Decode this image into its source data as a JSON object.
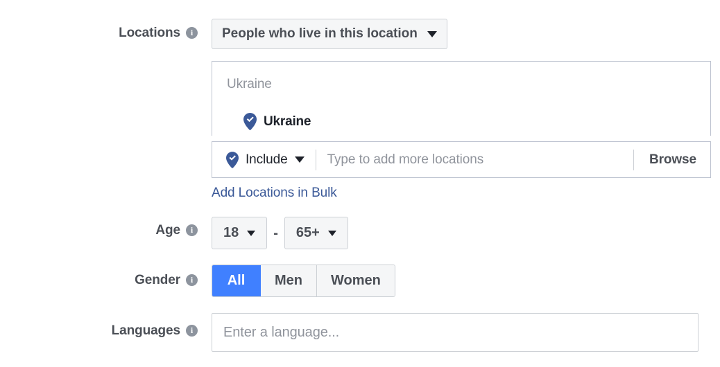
{
  "colors": {
    "brand_blue": "#3b5998",
    "accent_blue": "#4080ff",
    "label_gray": "#4b4f56",
    "placeholder_gray": "#90949c",
    "border_gray": "#ccd0d5",
    "box_border": "#bdc3d0",
    "field_bg": "#f5f6f7"
  },
  "locations": {
    "label": "Locations",
    "info_icon": "info-icon",
    "type_select": {
      "value": "People who live in this location",
      "caret_icon": "chevron-down-icon"
    },
    "results": {
      "group_header": "Ukraine",
      "items": [
        {
          "name": "Ukraine",
          "icon": "map-pin-check-icon"
        }
      ]
    },
    "input_row": {
      "mode": {
        "label": "Include",
        "icon": "map-pin-check-icon",
        "caret_icon": "chevron-down-icon"
      },
      "search_placeholder": "Type to add more locations",
      "search_value": "",
      "browse_label": "Browse"
    },
    "bulk_link": "Add Locations in Bulk"
  },
  "age": {
    "label": "Age",
    "info_icon": "info-icon",
    "min": "18",
    "separator": "-",
    "max": "65+",
    "caret_icon": "chevron-down-icon"
  },
  "gender": {
    "label": "Gender",
    "info_icon": "info-icon",
    "options": [
      {
        "label": "All",
        "selected": true
      },
      {
        "label": "Men",
        "selected": false
      },
      {
        "label": "Women",
        "selected": false
      }
    ]
  },
  "languages": {
    "label": "Languages",
    "info_icon": "info-icon",
    "placeholder": "Enter a language...",
    "value": ""
  }
}
